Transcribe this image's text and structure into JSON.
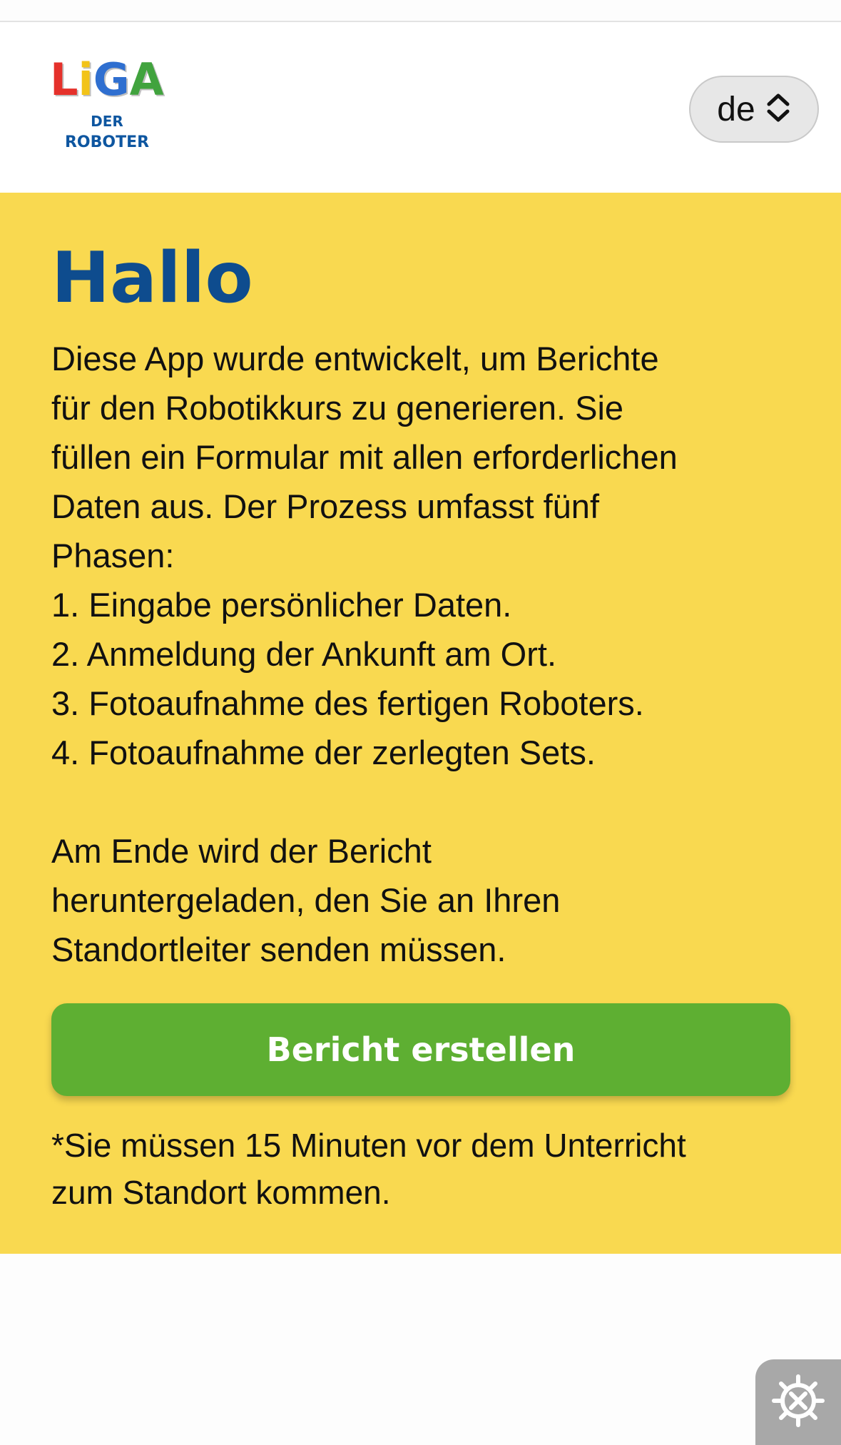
{
  "header": {
    "logo": {
      "letters": [
        "L",
        "i",
        "G",
        "A"
      ],
      "letter_colors": [
        "#e5312b",
        "#f2c318",
        "#2f6fd0",
        "#41a33e"
      ],
      "line1": "DER",
      "line2": "ROBOTER"
    },
    "language": {
      "value": "de",
      "icon": "chevron-up-down-icon"
    }
  },
  "main": {
    "title": "Hallo",
    "description_lines": [
      "Diese App wurde entwickelt, um Berichte",
      "für den Robotikkurs zu generieren. Sie",
      "füllen ein Formular mit allen erforderlichen",
      "Daten aus. Der Prozess umfasst fünf",
      "Phasen:",
      "1. Eingabe persönlicher Daten.",
      "2. Anmeldung der Ankunft am Ort.",
      "3. Fotoaufnahme des fertigen Roboters.",
      "4. Fotoaufnahme der zerlegten Sets."
    ],
    "ending_lines": [
      "Am Ende wird der Bericht",
      "heruntergeladen, den Sie an Ihren",
      "Standortleiter senden müssen."
    ],
    "cta_label": "Bericht erstellen",
    "note_lines": [
      "*Sie müssen 15 Minuten vor dem Unterricht",
      "zum Standort kommen."
    ]
  },
  "floating": {
    "icon": "gear-wrench-icon"
  },
  "colors": {
    "background_main": "#f9d950",
    "title": "#0e4c8e",
    "cta": "#5eaf32",
    "logo_subtext": "#0e56a0"
  }
}
